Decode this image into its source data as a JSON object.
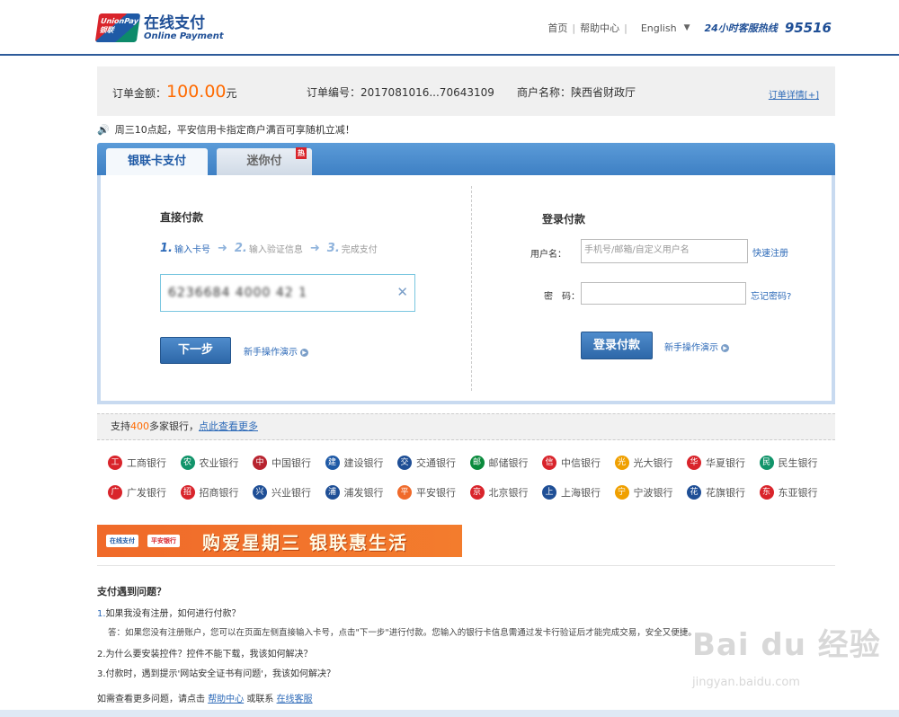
{
  "header": {
    "logo_box": "UnionPay 银联",
    "logo_title": "在线支付",
    "logo_sub": "Online Payment",
    "nav": [
      "首页",
      "帮助中心"
    ],
    "language": "English",
    "hotline_label": "24小时客服热线",
    "hotline_number": "95516"
  },
  "order": {
    "amount_label": "订单金额：",
    "amount": "100.00",
    "currency": "元",
    "number_label": "订单编号：",
    "number": "2017081016...70643109",
    "merchant_label": "商户名称：",
    "merchant": "陕西省财政厅",
    "detail_link": "订单详情[+]"
  },
  "notice": "周三10点起，平安信用卡指定商户满百可享随机立减！",
  "tabs": [
    {
      "label": "银联卡支付",
      "active": true
    },
    {
      "label": "迷你付",
      "badge": "热",
      "active": false
    }
  ],
  "direct": {
    "title": "直接付款",
    "steps": [
      {
        "num": "1.",
        "label": "输入卡号"
      },
      {
        "num": "2.",
        "label": "输入验证信息"
      },
      {
        "num": "3.",
        "label": "完成支付"
      }
    ],
    "card_value": "6236684 4000 42 1",
    "next_button": "下一步",
    "demo_link": "新手操作演示"
  },
  "login": {
    "title": "登录付款",
    "username_label": "用户名：",
    "username_placeholder": "手机号/邮箱/自定义用户名",
    "quick_register": "快速注册",
    "password_label": "密　码：",
    "forgot": "忘记密码?",
    "login_button": "登录付款",
    "demo_link": "新手操作演示"
  },
  "banks_bar": {
    "prefix": "支持",
    "count": "400",
    "suffix": "多家银行，",
    "link": "点此查看更多"
  },
  "banks": [
    {
      "name": "工商银行",
      "color": "#d9242b",
      "glyph": "工"
    },
    {
      "name": "农业银行",
      "color": "#11946a",
      "glyph": "农"
    },
    {
      "name": "中国银行",
      "color": "#b8232f",
      "glyph": "中"
    },
    {
      "name": "建设银行",
      "color": "#1f5aa6",
      "glyph": "建"
    },
    {
      "name": "交通银行",
      "color": "#1f4f96",
      "glyph": "交"
    },
    {
      "name": "邮储银行",
      "color": "#0a8a3c",
      "glyph": "邮"
    },
    {
      "name": "中信银行",
      "color": "#d9242b",
      "glyph": "信"
    },
    {
      "name": "光大银行",
      "color": "#f0a000",
      "glyph": "光"
    },
    {
      "name": "华夏银行",
      "color": "#d9242b",
      "glyph": "华"
    },
    {
      "name": "民生银行",
      "color": "#11946a",
      "glyph": "民"
    },
    {
      "name": "广发银行",
      "color": "#d9242b",
      "glyph": "广"
    },
    {
      "name": "招商银行",
      "color": "#d9242b",
      "glyph": "招"
    },
    {
      "name": "兴业银行",
      "color": "#1f4f96",
      "glyph": "兴"
    },
    {
      "name": "浦发银行",
      "color": "#1f4f96",
      "glyph": "浦"
    },
    {
      "name": "平安银行",
      "color": "#f06a2a",
      "glyph": "平"
    },
    {
      "name": "北京银行",
      "color": "#d9242b",
      "glyph": "京"
    },
    {
      "name": "上海银行",
      "color": "#1f4f96",
      "glyph": "上"
    },
    {
      "name": "宁波银行",
      "color": "#f0a000",
      "glyph": "宁"
    },
    {
      "name": "花旗银行",
      "color": "#1f4f96",
      "glyph": "花"
    },
    {
      "name": "东亚银行",
      "color": "#d9242b",
      "glyph": "东"
    }
  ],
  "promo": {
    "tag1": "在线支付",
    "tag2": "平安银行",
    "text": "购爱星期三 银联惠生活"
  },
  "faq": {
    "title": "支付遇到问题？",
    "q1_num": "1.",
    "q1": "如果我没有注册，如何进行付款？",
    "a1": "答：如果您没有注册账户，您可以在页面左侧直接输入卡号，点击\"下一步\"进行付款。您输入的银行卡信息需通过发卡行验证后才能完成交易，安全又便捷。",
    "q2": "2.为什么要安装控件？控件不能下载，我该如何解决？",
    "q3": "3.付款时，遇到提示'网站安全证书有问题'，我该如何解决？",
    "more_prefix": "如需查看更多问题，请点击",
    "help_link": "帮助中心",
    "or": "或联系",
    "service_link": "在线客服"
  },
  "watermark": {
    "main": "Bai du 经验",
    "sub": "jingyan.baidu.com"
  }
}
